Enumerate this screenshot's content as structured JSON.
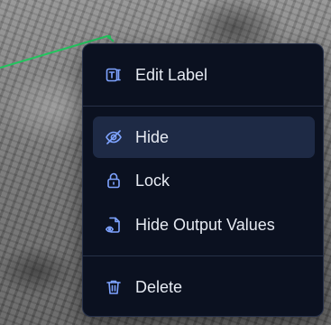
{
  "menu": {
    "items": [
      {
        "label": "Edit Label",
        "icon": "text-label-icon"
      },
      {
        "label": "Hide",
        "icon": "eye-off-icon",
        "active": true
      },
      {
        "label": "Lock",
        "icon": "lock-icon"
      },
      {
        "label": "Hide Output Values",
        "icon": "file-eye-icon"
      },
      {
        "label": "Delete",
        "icon": "trash-icon"
      }
    ]
  },
  "colors": {
    "menu_bg": "#0b1120",
    "active_bg": "#1e2a45",
    "icon": "#7ea3ff",
    "text": "#e6eaf2",
    "annotation_line": "#22c55e"
  }
}
